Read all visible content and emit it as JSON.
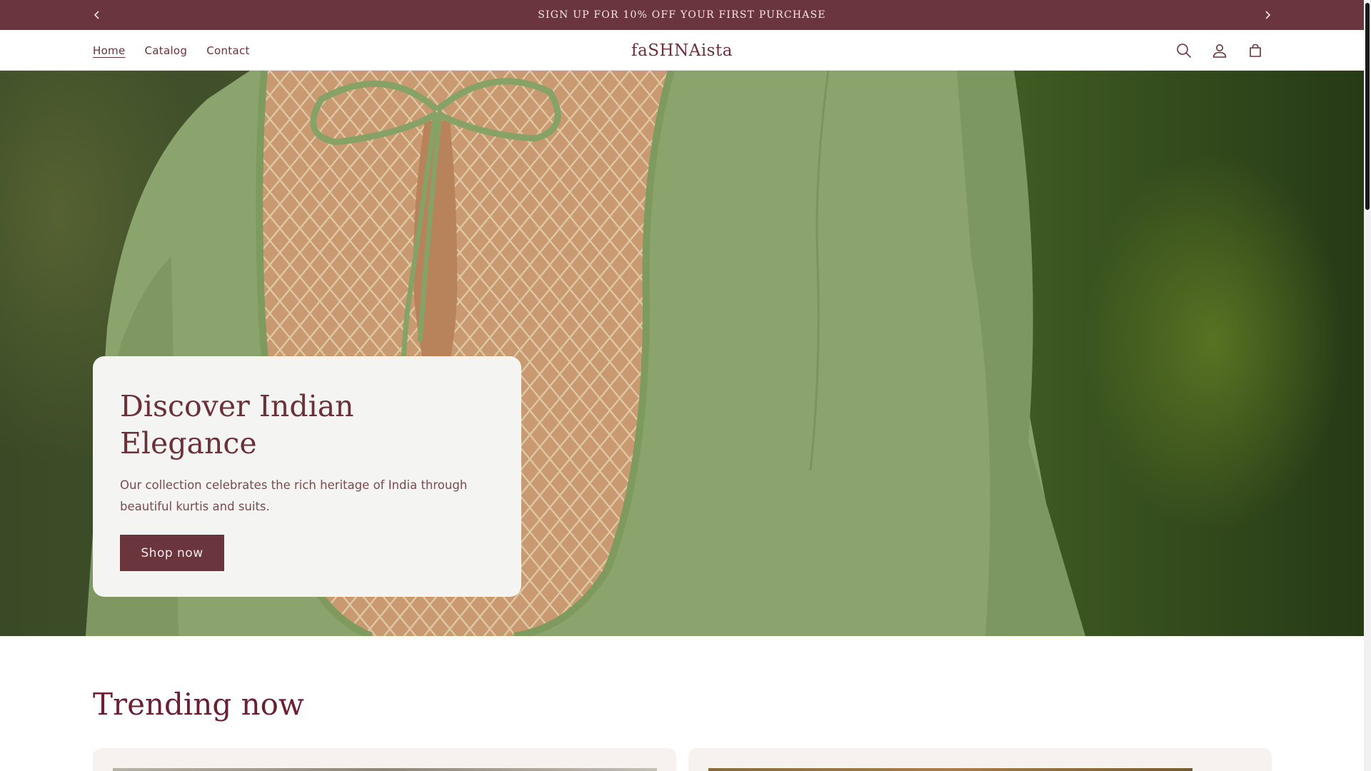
{
  "announcement": {
    "text": "SIGN UP FOR 10% OFF YOUR FIRST PURCHASE",
    "prev_icon": "chevron-left-icon",
    "next_icon": "chevron-right-icon"
  },
  "header": {
    "nav": [
      {
        "label": "Home",
        "active": true
      },
      {
        "label": "Catalog",
        "active": false
      },
      {
        "label": "Contact",
        "active": false
      }
    ],
    "logo": "faSHNAista",
    "icons": [
      "search-icon",
      "account-icon",
      "cart-icon"
    ]
  },
  "hero": {
    "title": "Discover Indian Elegance",
    "text": "Our collection celebrates the rich heritage of India through beautiful kurtis and suits.",
    "button_label": "Shop now"
  },
  "trending": {
    "title": "Trending now"
  },
  "colors": {
    "brand": "#6b353d",
    "heading": "#6b1f33",
    "card_bg": "#f4f4f2"
  }
}
